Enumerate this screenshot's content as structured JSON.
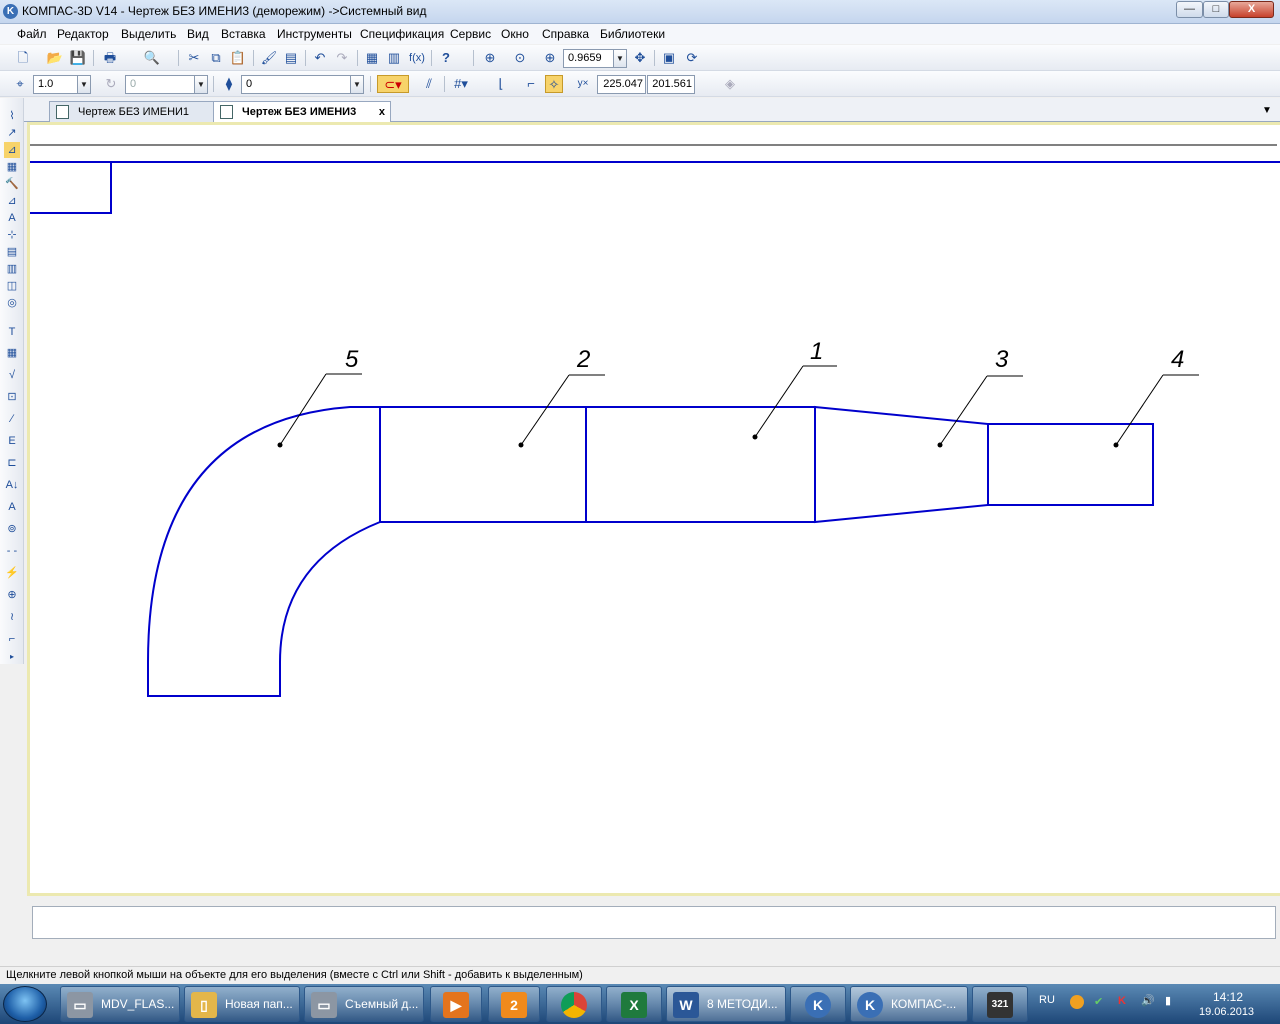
{
  "window": {
    "title": "КОМПАС-3D V14 - Чертеж БЕЗ ИМЕНИ3 (деморежим) ->Системный вид",
    "app_icon": "K",
    "min_glyph": "—",
    "max_glyph": "□",
    "close_glyph": "X"
  },
  "menu": [
    "Файл",
    "Редактор",
    "Выделить",
    "Вид",
    "Вставка",
    "Инструменты",
    "Спецификация",
    "Сервис",
    "Окно",
    "Справка",
    "Библиотеки"
  ],
  "toolbar": {
    "zoom_value": "0.9659",
    "step_value": "1.0",
    "angle_value": "0",
    "layer_value": "0",
    "coord_x": "225.047",
    "coord_y": "201.561",
    "fx_label": "f(x)",
    "help_label": "?"
  },
  "tabs": [
    {
      "label": "Чертеж БЕЗ ИМЕНИ1",
      "active": false
    },
    {
      "label": "Чертеж БЕЗ ИМЕНИ3",
      "active": true
    }
  ],
  "tab_close": "x",
  "drawing": {
    "line_color": "#0000cc",
    "leader_color": "#000000",
    "labels": [
      "5",
      "2",
      "1",
      "3",
      "4"
    ]
  },
  "status": "Щелкните левой кнопкой мыши на объекте для его выделения (вместе с Ctrl или Shift - добавить к выделенным)",
  "taskbar": {
    "items": [
      {
        "label": "MDV_FLAS...",
        "icon": "drive-icon"
      },
      {
        "label": "Новая пап...",
        "icon": "folder-icon"
      },
      {
        "label": "Съемный д...",
        "icon": "drive-icon"
      },
      {
        "label": "",
        "icon": "media-player-icon"
      },
      {
        "label": "",
        "icon": "browser-2-icon"
      },
      {
        "label": "",
        "icon": "chrome-icon"
      },
      {
        "label": "",
        "icon": "excel-icon"
      },
      {
        "label": "8 МЕТОДИ...",
        "icon": "word-icon"
      },
      {
        "label": "",
        "icon": "kompas-viewer-icon"
      },
      {
        "label": "КОМПАС-...",
        "icon": "kompas-icon"
      },
      {
        "label": "",
        "icon": "media-321-icon"
      }
    ],
    "language": "RU",
    "time": "14:12",
    "date": "19.06.2013"
  }
}
